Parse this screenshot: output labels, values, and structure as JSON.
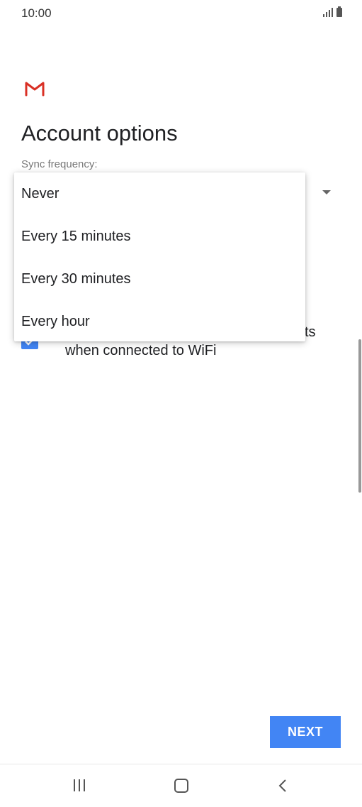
{
  "status_bar": {
    "time": "10:00"
  },
  "page": {
    "title": "Account options",
    "sync_label": "Sync frequency:"
  },
  "dropdown": {
    "options": [
      {
        "label": "Never"
      },
      {
        "label": "Every 15 minutes"
      },
      {
        "label": "Every 30 minutes"
      },
      {
        "label": "Every hour"
      }
    ]
  },
  "wifi_option": {
    "checked": true,
    "label_tail": "ts",
    "label_line2": "when connected to WiFi"
  },
  "footer": {
    "next_label": "NEXT"
  },
  "icons": {
    "app": "gmail-icon",
    "dropdown": "dropdown-arrow-icon",
    "checkbox": "checkmark-icon",
    "nav_recent": "recent-apps-icon",
    "nav_home": "home-icon",
    "nav_back": "back-icon"
  },
  "colors": {
    "accent": "#4285f4",
    "gmail_red": "#d93025"
  }
}
